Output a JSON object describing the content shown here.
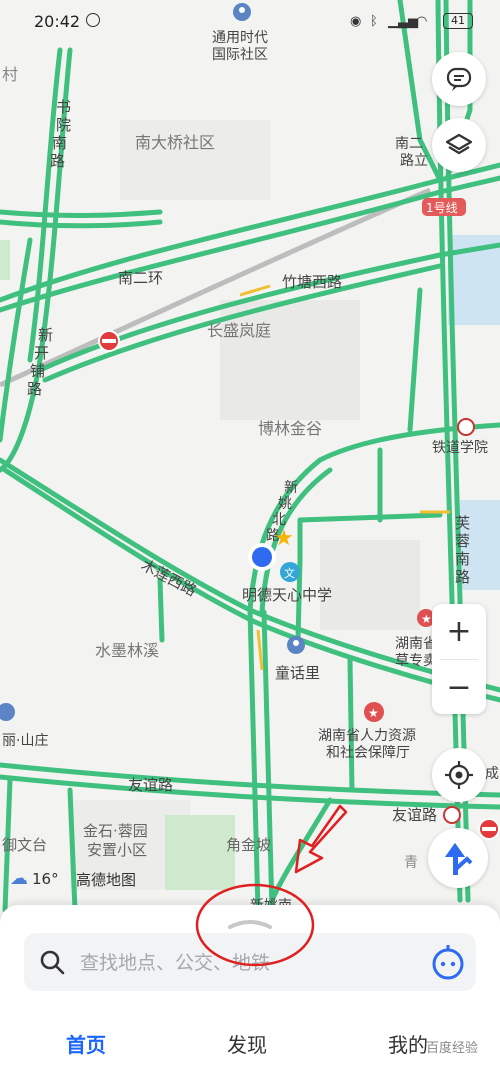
{
  "status_bar": {
    "time": "20:42",
    "battery": "41"
  },
  "map": {
    "labels": [
      {
        "id": "tongyong",
        "text": "通用时代\n国际社区"
      },
      {
        "id": "nandaqiao",
        "text": "南大桥社区"
      },
      {
        "id": "shuyuan",
        "text": "书院南路"
      },
      {
        "id": "nan2",
        "text": "南二环"
      },
      {
        "id": "zhutang",
        "text": "竹塘西路"
      },
      {
        "id": "changsheng",
        "text": "长盛岚庭"
      },
      {
        "id": "xinkai",
        "text": "新开铺路"
      },
      {
        "id": "bolin",
        "text": "博林金谷"
      },
      {
        "id": "tiedao",
        "text": "铁道学院"
      },
      {
        "id": "xinyao",
        "text": "新姚北路"
      },
      {
        "id": "furong",
        "text": "芙蓉南路"
      },
      {
        "id": "mude",
        "text": "明德天心中学"
      },
      {
        "id": "mulian",
        "text": "木莲西路"
      },
      {
        "id": "shuimo",
        "text": "水墨林溪"
      },
      {
        "id": "tonghua",
        "text": "童话里"
      },
      {
        "id": "hunan1",
        "text": "湖南省\n草专卖"
      },
      {
        "id": "hunan2",
        "text": "湖南省人力资源\n和社会保障厅"
      },
      {
        "id": "youyi",
        "text": "友谊路"
      },
      {
        "id": "youyi2",
        "text": "友谊路"
      },
      {
        "id": "jinshi",
        "text": "金石·蓉园\n安置小区"
      },
      {
        "id": "jiaojin",
        "text": "角金坡"
      },
      {
        "id": "yuwen",
        "text": "御文台"
      },
      {
        "id": "lishan",
        "text": "丽·山庄"
      },
      {
        "id": "line1",
        "text": "1号线"
      },
      {
        "id": "nanhu",
        "text": "南二\n路立"
      },
      {
        "id": "cun",
        "text": "村"
      },
      {
        "id": "qing",
        "text": "青"
      },
      {
        "id": "cheng",
        "text": "成"
      },
      {
        "id": "xinyaonan",
        "text": "新姚南"
      }
    ]
  },
  "weather": {
    "temp": "16°"
  },
  "brand": "高德地图",
  "search": {
    "placeholder": "查找地点、公交、地铁"
  },
  "tabs": [
    {
      "label": "首页"
    },
    {
      "label": "发现"
    },
    {
      "label": "我的"
    }
  ],
  "watermark": "百度经验",
  "colors": {
    "road": "#3fc07f",
    "accent": "#1a66ff",
    "annotation": "#e02020",
    "location": "#2f6bf0"
  }
}
